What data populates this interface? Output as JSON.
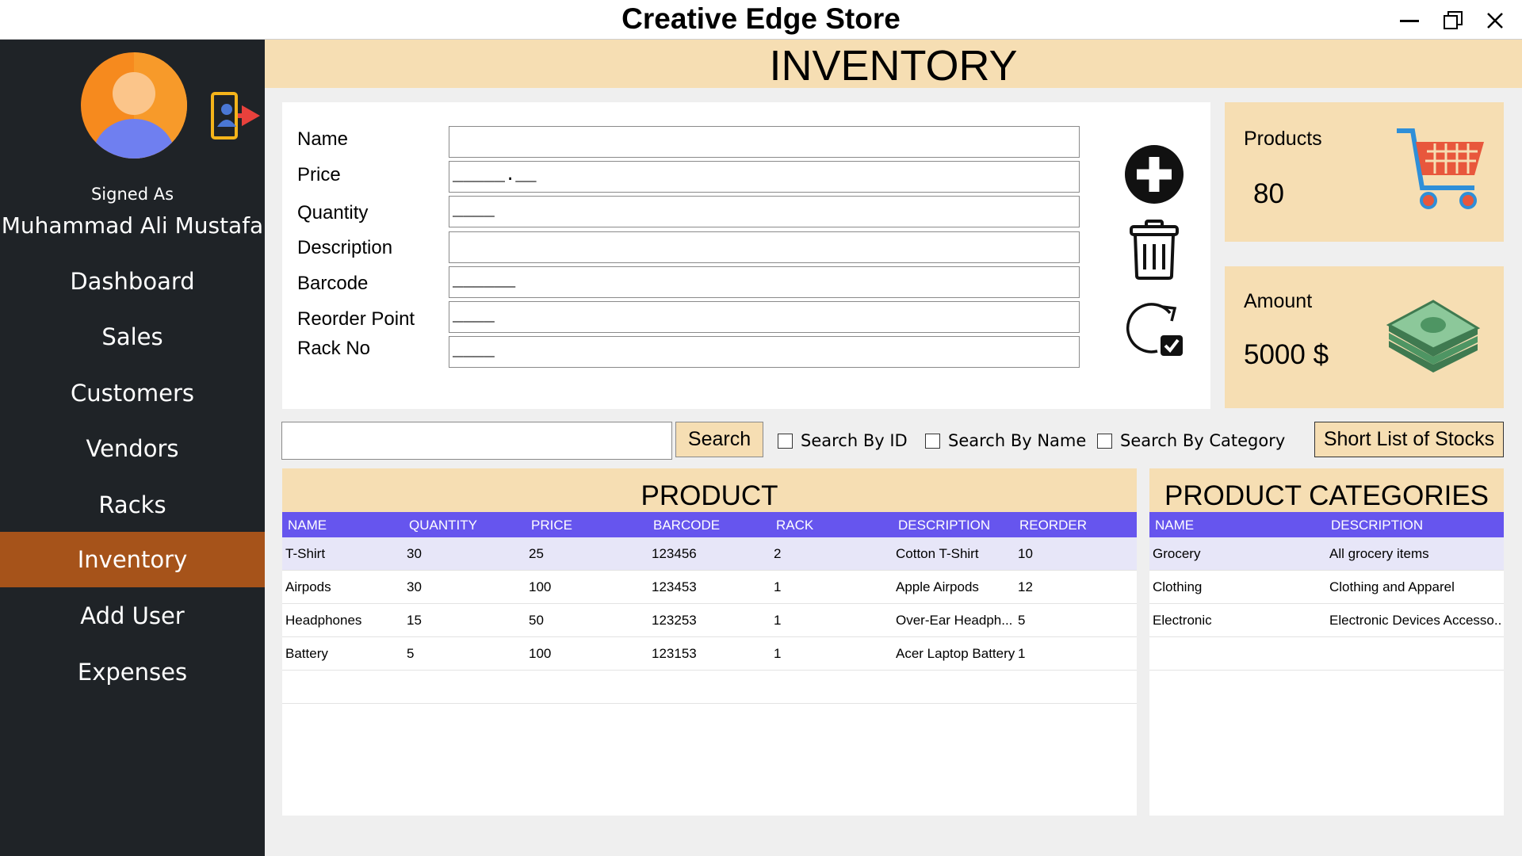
{
  "window": {
    "title": "Creative Edge Store",
    "minimize": "—",
    "restore": "❐",
    "close": "X"
  },
  "sidebar": {
    "signed_as_label": "Signed As",
    "user_name": "Muhammad Ali Mustafa",
    "items": [
      {
        "label": "Dashboard",
        "active": false
      },
      {
        "label": "Sales",
        "active": false
      },
      {
        "label": "Customers",
        "active": false
      },
      {
        "label": "Vendors",
        "active": false
      },
      {
        "label": "Racks",
        "active": false
      },
      {
        "label": "Inventory",
        "active": true
      },
      {
        "label": "Add User",
        "active": false
      },
      {
        "label": "Expenses",
        "active": false
      }
    ]
  },
  "header": {
    "title": "INVENTORY"
  },
  "form": {
    "fields": [
      {
        "label": "Name",
        "value": ""
      },
      {
        "label": "Price",
        "value": "_____.__"
      },
      {
        "label": "Quantity",
        "value": "____"
      },
      {
        "label": "Description",
        "value": ""
      },
      {
        "label": "Barcode",
        "value": "______"
      },
      {
        "label": "Reorder Point",
        "value": "____"
      },
      {
        "label": "Rack No",
        "value": "____"
      }
    ]
  },
  "stats": {
    "products": {
      "label": "Products",
      "value": "80"
    },
    "amount": {
      "label": "Amount",
      "value": "5000 $"
    }
  },
  "search": {
    "button_label": "Search",
    "value": "",
    "options": [
      "Search By ID",
      "Search By Name",
      "Search By Category"
    ],
    "shortlist_label": "Short List of Stocks"
  },
  "products_table": {
    "title": "PRODUCT",
    "columns": [
      "NAME",
      "QUANTITY",
      "PRICE",
      "BARCODE",
      "RACK",
      "DESCRIPTION",
      "REORDER"
    ],
    "rows": [
      [
        "T-Shirt",
        "30",
        "25",
        "123456",
        "2",
        "Cotton T-Shirt",
        "10"
      ],
      [
        "Airpods",
        "30",
        "100",
        "123453",
        "1",
        "Apple Airpods",
        "12"
      ],
      [
        "Headphones",
        "15",
        "50",
        "123253",
        "1",
        "Over-Ear Headph...",
        "5"
      ],
      [
        "Battery",
        "5",
        "100",
        "123153",
        "1",
        "Acer Laptop Battery",
        "1"
      ]
    ]
  },
  "categories_table": {
    "title": "PRODUCT CATEGORIES",
    "columns": [
      "NAME",
      "DESCRIPTION"
    ],
    "rows": [
      [
        "Grocery",
        "All grocery items"
      ],
      [
        "Clothing",
        "Clothing and Apparel"
      ],
      [
        "Electronic",
        "Electronic Devices Accesso..."
      ]
    ]
  },
  "colors": {
    "sidebar_bg": "#1f2327",
    "active_nav": "#a6531a",
    "header_bg": "#f6deb3",
    "table_header": "#6655ee",
    "selected_row": "#e7e6f8"
  },
  "icons": {
    "avatar": "user-avatar-icon",
    "logout": "logout-icon",
    "add": "plus-circle-icon",
    "delete": "trash-icon",
    "update": "refresh-check-icon",
    "products": "shopping-cart-icon",
    "amount": "money-stack-icon"
  }
}
